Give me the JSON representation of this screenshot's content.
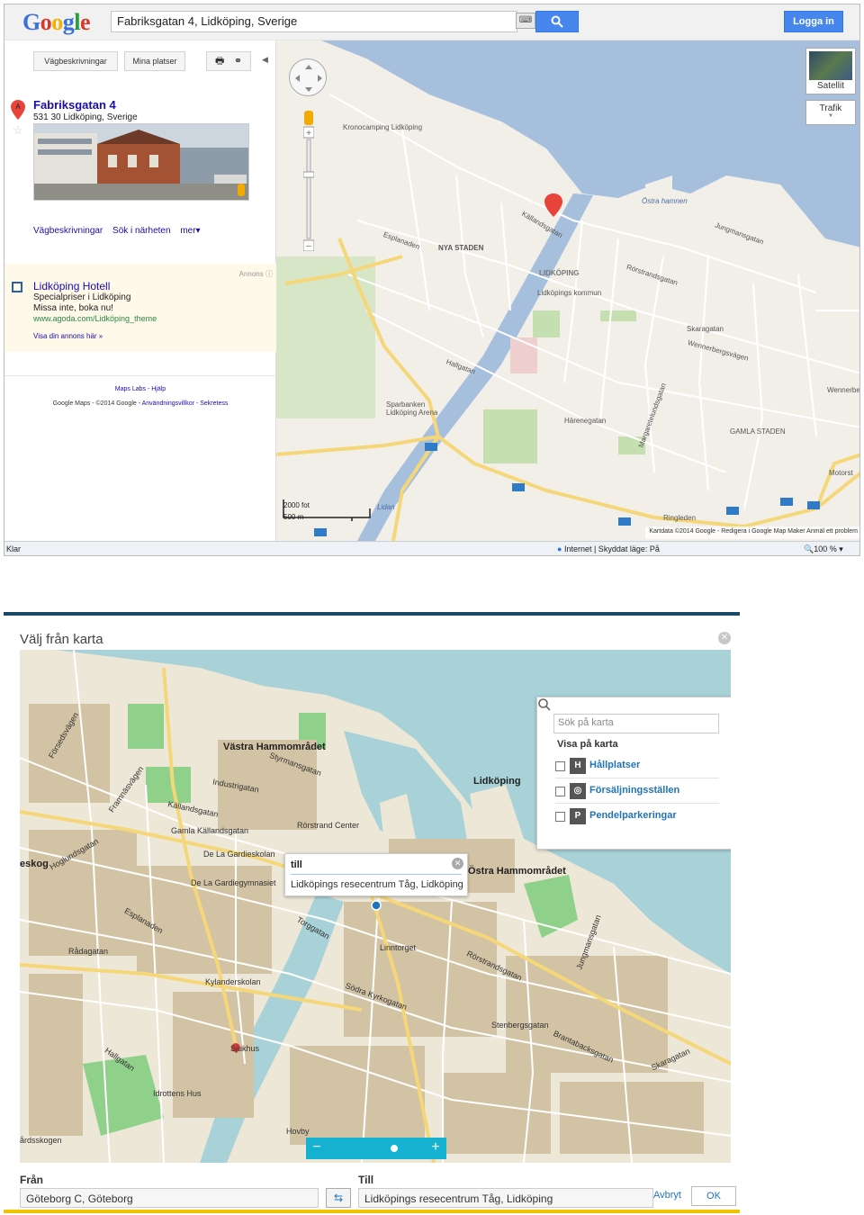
{
  "google_maps": {
    "logo": "Google",
    "search_value": "Fabriksgatan 4, Lidköping, Sverige",
    "login_label": "Logga in",
    "toolbar": {
      "directions_label": "Vägbeskrivningar",
      "my_places_label": "Mina platser"
    },
    "result": {
      "marker": "A",
      "title": "Fabriksgatan 4",
      "address": "531 30 Lidköping, Sverige"
    },
    "result_links": [
      "Vägbeskrivningar",
      "Sök i närheten",
      "mer▾"
    ],
    "ad": {
      "label": "Annons",
      "title": "Lidköping Hotell",
      "line1": "Specialpriser i Lidköping",
      "line2": "Missa inte, boka nu!",
      "url": "www.agoda.com/Lidköping_theme",
      "own_ad": "Visa din annons här »"
    },
    "footer": {
      "line1": "Maps Labs - Hjälp",
      "prefix": "Google Maps",
      "copyright": "- ©2014 Google",
      "terms": "- Användningsvillkor - Sekretess"
    },
    "map_controls": {
      "satellite_label": "Satellit",
      "traffic_label": "Trafik",
      "scale_ft": "2000 fot",
      "scale_m": "500 m",
      "copyright": "Kartdata ©2014 Google - Redigera i Google Map Maker   Anmäl ett problem"
    },
    "map_labels": {
      "kronocamping": "Kronocamping Lidköping",
      "nya_staden": "NYA STADEN",
      "lidkoping": "LIDKÖPING",
      "kommun": "Lidköpings kommun",
      "ostra_hamnen": "Östra hamnen",
      "rorstrandsgatan": "Rörstrandsgatan",
      "kallandsgatan": "Källandsgatan",
      "esplanaden": "Esplanaden",
      "skaragatan": "Skaragatan",
      "wennerbergsvagen": "Wennerbergsvägen",
      "sparbanken": "Sparbanken Lidköping Arena",
      "gamla_staden": "GAMLA STADEN",
      "harenegatan": "Härenegatan",
      "ringleden": "Ringleden",
      "hallgatan": "Hallgatan",
      "jungmansgatan": "Jungmansgatan",
      "margaretelundsgatan": "Margaretelundsgatan",
      "lidan": "Lidan",
      "motorst": "Motorst",
      "wennerbe": "Wennerbe"
    },
    "status": {
      "left": "Klar",
      "zone": "Internet | Skyddat läge: På",
      "zoom": "100 %"
    }
  },
  "dialog": {
    "title": "Välj från karta",
    "search_placeholder": "Sök på karta",
    "show_on_map": "Visa på karta",
    "layers": [
      {
        "icon": "H",
        "label": "Hållplatser"
      },
      {
        "icon": "◎",
        "label": "Försäljningsställen"
      },
      {
        "icon": "P",
        "label": "Pendelparkeringar"
      }
    ],
    "popup": {
      "title": "till",
      "body": "Lidköpings resecentrum Tåg, Lidköping"
    },
    "map_labels": {
      "vastra": "Västra Hammområdet",
      "ostra": "Östra Hammområdet",
      "lidkoping": "Lidköping",
      "industrigatan": "Industrigatan",
      "kallandsgatan": "Källandsgatan",
      "gamla_kallandsgatan": "Gamla Källandsgatan",
      "rostrand": "Rörstrand Center",
      "degardieskolan": "De La Gardieskolan",
      "degardiegymnasiet": "De La Gardiegymnasiet",
      "styrmansgatan": "Styrmansgatan",
      "esplanaden": "Esplanaden",
      "rorstrandsgatan": "Rörstrandsgatan",
      "kylanderskolan": "Kylanderskolan",
      "sjukhus": "Sjukhus",
      "idrottens_hus": "Idrottens Hus",
      "sodra_kyrkogatan": "Södra Kyrkogatan",
      "skaragatan": "Skaragatan",
      "brantabacksgatan": "Brantabacksgatan",
      "jungmansgatan": "Jungmansgatan",
      "hallgatan": "Hallgatan",
      "torggatan": "Torggatan",
      "stenbergsgatan": "Stenbergsgatan",
      "forsedsvagen": "Försedsvägen",
      "framnasvagen": "Framnäsvägen",
      "hoglundsgatan": "Hoglundsgatan",
      "radagatan": "Rådagatan",
      "linntorget": "Linntorget",
      "ardsskogen": "årdsskogen",
      "hovby": "Hovby",
      "eskog": "eskog"
    },
    "from_label": "Från",
    "to_label": "Till",
    "from_value": "Göteborg C, Göteborg",
    "to_value": "Lidköpings resecentrum Tåg, Lidköping",
    "cancel_label": "Avbryt",
    "ok_label": "OK"
  },
  "colors": {
    "google_blue": "#4787ed",
    "water": "#a5bfdd",
    "dialog_water": "#a8d2d8",
    "road_yellow": "#f5d77a",
    "accent_cyan": "#14b1d1",
    "accent_yellow": "#f2c400"
  }
}
